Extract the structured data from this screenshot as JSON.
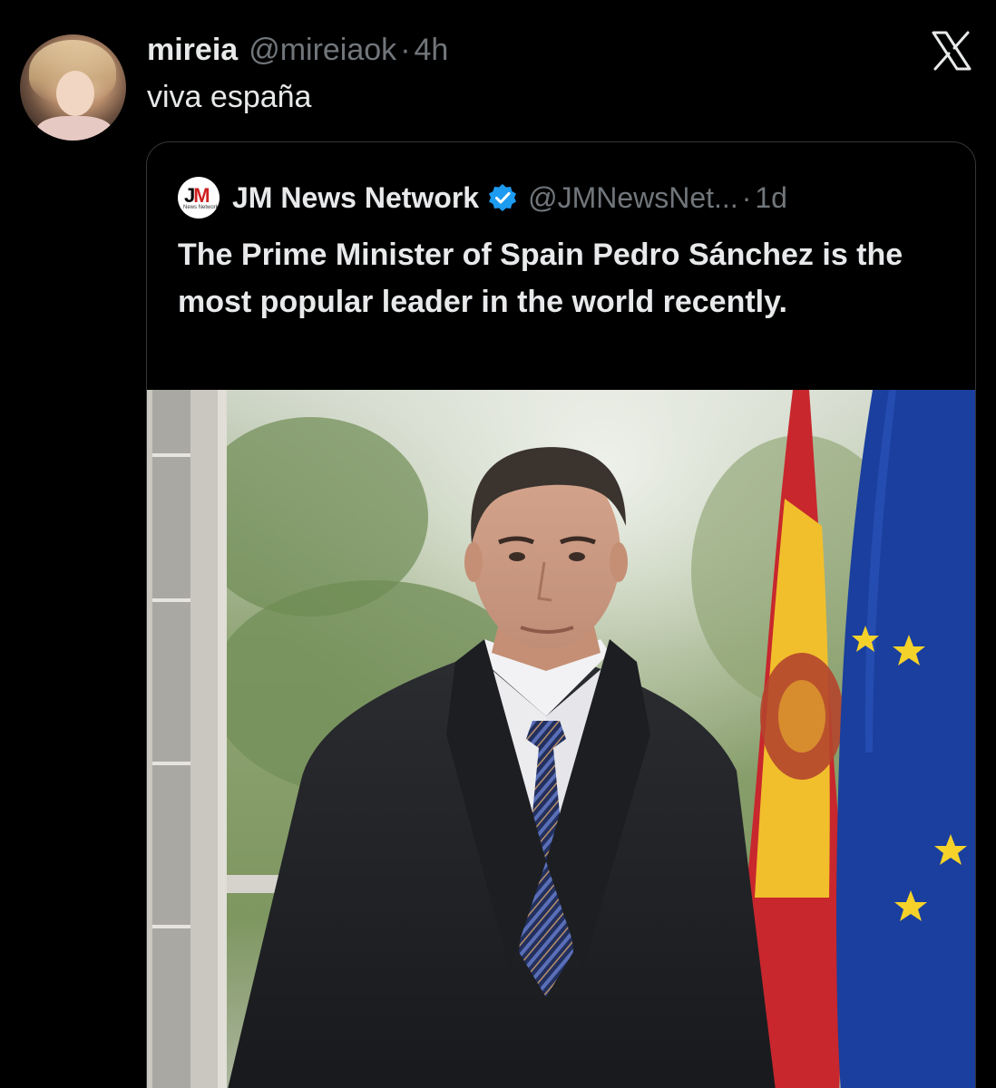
{
  "post": {
    "author_name": "mireia",
    "author_handle": "@mireiaok",
    "dot": "·",
    "time": "4h",
    "text": "viva españa"
  },
  "quote": {
    "logo_text": "JM",
    "logo_subtext": "News Network",
    "author_name": "JM News Network",
    "author_handle": "@JMNewsNet...",
    "dot": "·",
    "time": "1d",
    "text": "The Prime Minister of Spain Pedro Sánchez is the most popular leader in the world recently."
  },
  "icons": {
    "close": "x-logo-icon",
    "verified": "verified-badge-icon"
  },
  "colors": {
    "background": "#000000",
    "text_primary": "#e7e9ea",
    "text_secondary": "#71767b",
    "verified_blue": "#1d9bf0",
    "border": "#333639"
  }
}
